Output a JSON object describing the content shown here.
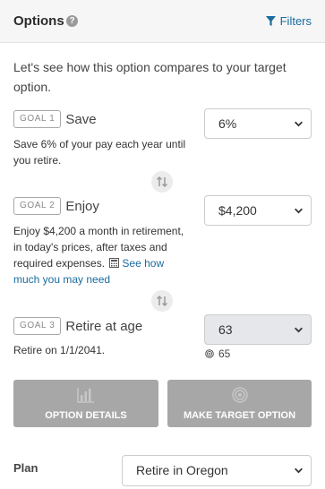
{
  "header": {
    "title": "Options",
    "help_icon": "?",
    "filters_label": "Filters"
  },
  "intro": "Let's see how this option compares to your target option.",
  "goals": [
    {
      "badge": "GOAL 1",
      "name": "Save",
      "description": "Save 6% of your pay each year until you retire.",
      "selected": "6%"
    },
    {
      "badge": "GOAL 2",
      "name": "Enjoy",
      "description_prefix": "Enjoy $4,200 a month in retirement, in today's prices, after taxes and required expenses.",
      "link_label": "See how much you may need",
      "selected": "$4,200"
    },
    {
      "badge": "GOAL 3",
      "name": "Retire at age",
      "description": "Retire on 1/1/2041.",
      "selected": "63",
      "target_value": "65"
    }
  ],
  "buttons": {
    "option_details": "OPTION DETAILS",
    "make_target": "MAKE TARGET OPTION"
  },
  "plan": {
    "label": "Plan",
    "selected": "Retire in Oregon"
  },
  "colors": {
    "link": "#1a6ba0",
    "button_disabled": "#a7a7a7",
    "header_bg": "#f6f6f6"
  },
  "icons": [
    "help-icon",
    "filter-icon",
    "swap-icon",
    "chevron-down-icon",
    "calculator-icon",
    "target-icon",
    "bar-chart-icon"
  ]
}
